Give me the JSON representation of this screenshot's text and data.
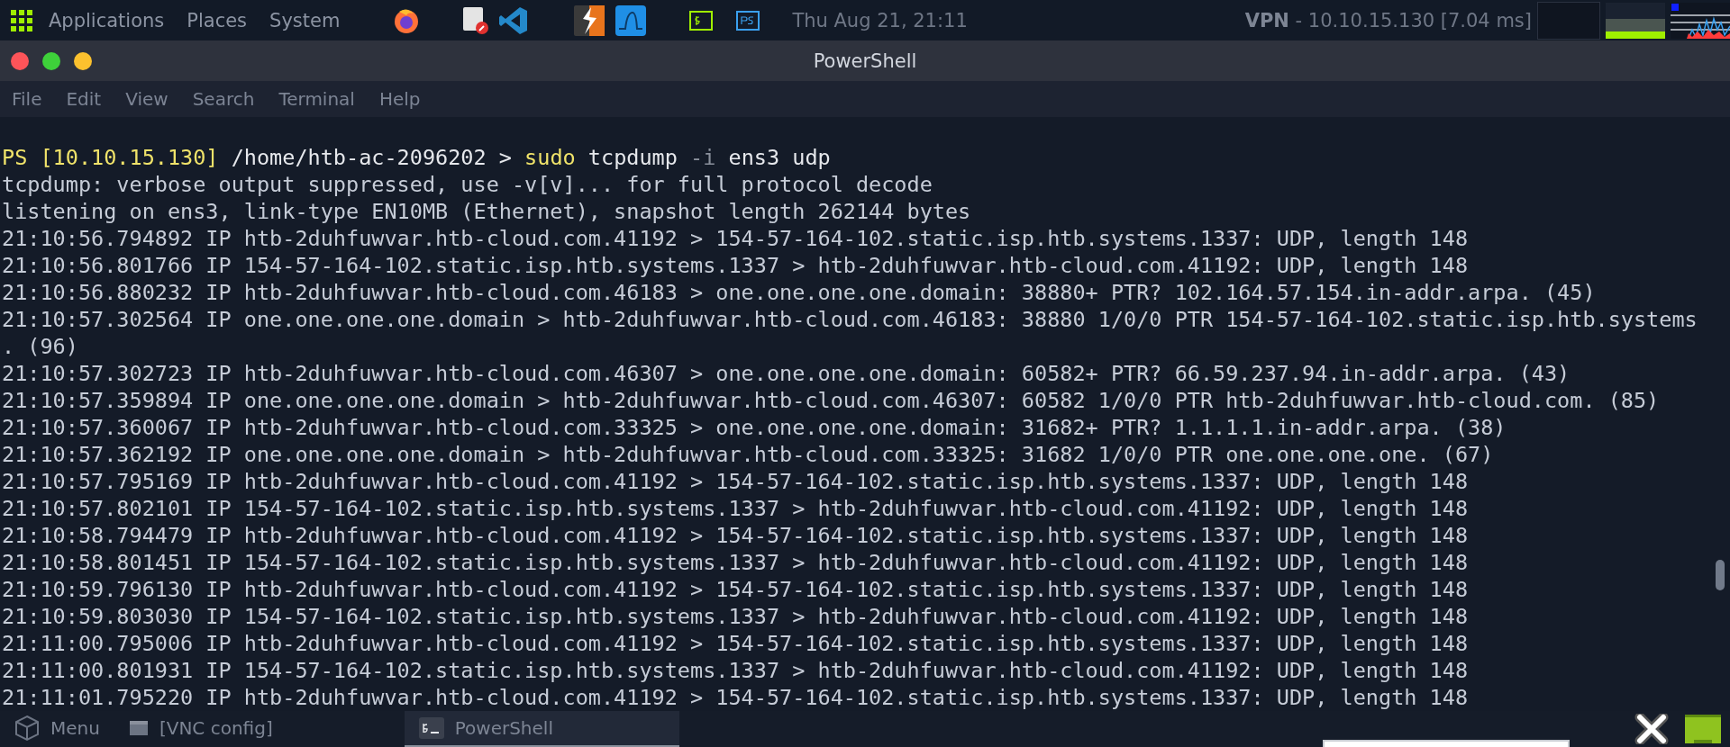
{
  "top_panel": {
    "menus": [
      "Applications",
      "Places",
      "System"
    ],
    "clock": "Thu Aug 21, 21:11",
    "vpn": {
      "label": "VPN",
      "detail": "- 10.10.15.130 [7.04 ms]"
    }
  },
  "window": {
    "title": "PowerShell",
    "menu": [
      "File",
      "Edit",
      "View",
      "Search",
      "Terminal",
      "Help"
    ]
  },
  "terminal": {
    "prompt": [
      {
        "kind": "ps",
        "text": "PS [10.10.15.130]"
      },
      {
        "kind": "path",
        "text": "/home/htb-ac-2096202 >"
      },
      {
        "kind": "command",
        "text": "sudo"
      },
      {
        "kind": "plain",
        "text": "tcpdump"
      },
      {
        "kind": "flag",
        "text": "-i"
      },
      {
        "kind": "plain",
        "text": "ens3 udp"
      }
    ],
    "lines": [
      "tcpdump: verbose output suppressed, use -v[v]... for full protocol decode",
      "listening on ens3, link-type EN10MB (Ethernet), snapshot length 262144 bytes",
      "21:10:56.794892 IP htb-2duhfuwvar.htb-cloud.com.41192 > 154-57-164-102.static.isp.htb.systems.1337: UDP, length 148",
      "21:10:56.801766 IP 154-57-164-102.static.isp.htb.systems.1337 > htb-2duhfuwvar.htb-cloud.com.41192: UDP, length 148",
      "21:10:56.880232 IP htb-2duhfuwvar.htb-cloud.com.46183 > one.one.one.one.domain: 38880+ PTR? 102.164.57.154.in-addr.arpa. (45)",
      "21:10:57.302564 IP one.one.one.one.domain > htb-2duhfuwvar.htb-cloud.com.46183: 38880 1/0/0 PTR 154-57-164-102.static.isp.htb.systems",
      ". (96)",
      "21:10:57.302723 IP htb-2duhfuwvar.htb-cloud.com.46307 > one.one.one.one.domain: 60582+ PTR? 66.59.237.94.in-addr.arpa. (43)",
      "21:10:57.359894 IP one.one.one.one.domain > htb-2duhfuwvar.htb-cloud.com.46307: 60582 1/0/0 PTR htb-2duhfuwvar.htb-cloud.com. (85)",
      "21:10:57.360067 IP htb-2duhfuwvar.htb-cloud.com.33325 > one.one.one.one.domain: 31682+ PTR? 1.1.1.1.in-addr.arpa. (38)",
      "21:10:57.362192 IP one.one.one.one.domain > htb-2duhfuwvar.htb-cloud.com.33325: 31682 1/0/0 PTR one.one.one.one. (67)",
      "21:10:57.795169 IP htb-2duhfuwvar.htb-cloud.com.41192 > 154-57-164-102.static.isp.htb.systems.1337: UDP, length 148",
      "21:10:57.802101 IP 154-57-164-102.static.isp.htb.systems.1337 > htb-2duhfuwvar.htb-cloud.com.41192: UDP, length 148",
      "21:10:58.794479 IP htb-2duhfuwvar.htb-cloud.com.41192 > 154-57-164-102.static.isp.htb.systems.1337: UDP, length 148",
      "21:10:58.801451 IP 154-57-164-102.static.isp.htb.systems.1337 > htb-2duhfuwvar.htb-cloud.com.41192: UDP, length 148",
      "21:10:59.796130 IP htb-2duhfuwvar.htb-cloud.com.41192 > 154-57-164-102.static.isp.htb.systems.1337: UDP, length 148",
      "21:10:59.803030 IP 154-57-164-102.static.isp.htb.systems.1337 > htb-2duhfuwvar.htb-cloud.com.41192: UDP, length 148",
      "21:11:00.795006 IP htb-2duhfuwvar.htb-cloud.com.41192 > 154-57-164-102.static.isp.htb.systems.1337: UDP, length 148",
      "21:11:00.801931 IP 154-57-164-102.static.isp.htb.systems.1337 > htb-2duhfuwvar.htb-cloud.com.41192: UDP, length 148",
      "21:11:01.795220 IP htb-2duhfuwvar.htb-cloud.com.41192 > 154-57-164-102.static.isp.htb.systems.1337: UDP, length 148"
    ]
  },
  "taskbar": {
    "items": [
      {
        "kind": "menu",
        "label": "Menu",
        "selected": false
      },
      {
        "kind": "window",
        "label": "[VNC config]",
        "selected": false
      },
      {
        "kind": "terminal",
        "label": "PowerShell",
        "selected": true
      }
    ]
  }
}
